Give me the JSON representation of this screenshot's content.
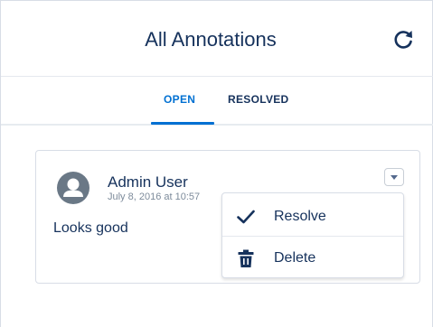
{
  "header": {
    "title": "All Annotations",
    "refresh_icon": "refresh-icon"
  },
  "tabs": [
    {
      "label": "OPEN",
      "active": true
    },
    {
      "label": "RESOLVED",
      "active": false
    }
  ],
  "annotation": {
    "author": "Admin User",
    "timestamp": "July 8, 2016 at 10:57",
    "comment": "Looks good",
    "avatar_icon": "user-avatar-icon",
    "menu_icon": "chevron-down-icon"
  },
  "menu": {
    "items": [
      {
        "label": "Resolve",
        "icon": "check-icon"
      },
      {
        "label": "Delete",
        "icon": "trash-icon"
      }
    ]
  },
  "colors": {
    "accent": "#0070d2",
    "text": "#16325c",
    "muted": "#7d8b9b",
    "avatar": "#6a7886"
  }
}
